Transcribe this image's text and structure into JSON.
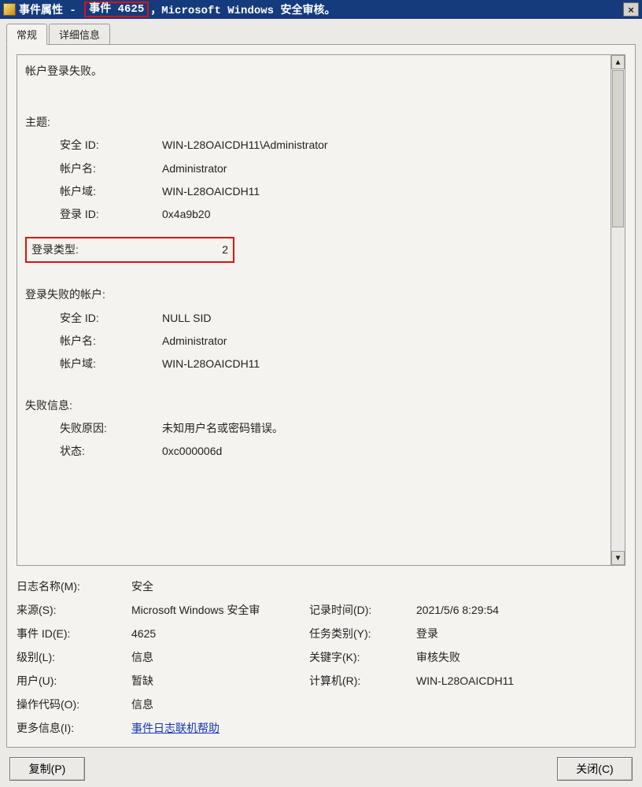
{
  "titlebar": {
    "prefix": "事件属性 - ",
    "highlight": "事件 4625",
    "suffix": "，Microsoft Windows 安全审核。",
    "close": "×"
  },
  "tabs": {
    "general": "常规",
    "details": "详细信息"
  },
  "description": {
    "headline": "帐户登录失败。",
    "subject_title": "主题:",
    "subject": {
      "sid_label": "安全 ID:",
      "sid_value": "WIN-L28OAICDH11\\Administrator",
      "account_label": "帐户名:",
      "account_value": "Administrator",
      "domain_label": "帐户域:",
      "domain_value": "WIN-L28OAICDH11",
      "logonid_label": "登录 ID:",
      "logonid_value": "0x4a9b20"
    },
    "logon_type_label": "登录类型:",
    "logon_type_value": "2",
    "failed_account_title": "登录失败的帐户:",
    "failed": {
      "sid_label": "安全 ID:",
      "sid_value": "NULL SID",
      "account_label": "帐户名:",
      "account_value": "Administrator",
      "domain_label": "帐户域:",
      "domain_value": "WIN-L28OAICDH11"
    },
    "failure_info_title": "失败信息:",
    "failure": {
      "reason_label": "失败原因:",
      "reason_value": "未知用户名或密码错误。",
      "status_label": "状态:",
      "status_value": "0xc000006d"
    }
  },
  "info": {
    "log_name_label": "日志名称(M):",
    "log_name_value": "安全",
    "source_label": "来源(S):",
    "source_value": "Microsoft Windows 安全审",
    "logged_label": "记录时间(D):",
    "logged_value": "2021/5/6 8:29:54",
    "eventid_label": "事件 ID(E):",
    "eventid_value": "4625",
    "taskcat_label": "任务类别(Y):",
    "taskcat_value": "登录",
    "level_label": "级别(L):",
    "level_value": "信息",
    "keywords_label": "关键字(K):",
    "keywords_value": "审核失败",
    "user_label": "用户(U):",
    "user_value": "暂缺",
    "computer_label": "计算机(R):",
    "computer_value": "WIN-L28OAICDH11",
    "opcode_label": "操作代码(O):",
    "opcode_value": "信息",
    "moreinfo_label": "更多信息(I):",
    "moreinfo_link": "事件日志联机帮助"
  },
  "nav": {
    "up": "⬆",
    "down": "⬇"
  },
  "buttons": {
    "copy": "复制(P)",
    "close": "关闭(C)"
  },
  "scrollbar": {
    "up": "▲",
    "down": "▼"
  }
}
